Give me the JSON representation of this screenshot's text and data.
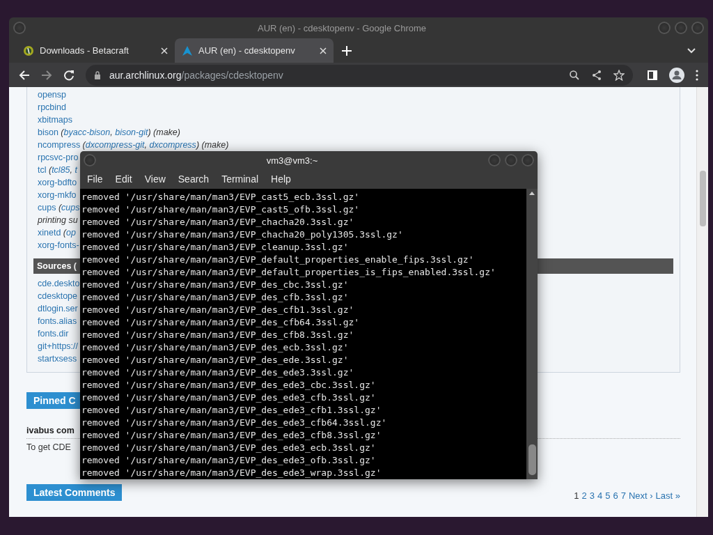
{
  "browser": {
    "window_title": "AUR (en) - cdesktopenv - Google Chrome",
    "tabs": [
      {
        "title": "Downloads - Betacraft",
        "selected": false
      },
      {
        "title": "AUR (en) - cdesktopenv",
        "selected": true
      }
    ],
    "address": {
      "domain": "aur.archlinux.org",
      "path": "/packages/cdesktopenv"
    }
  },
  "page": {
    "dependencies": [
      {
        "parts": [
          {
            "text": "opensp",
            "kind": "link"
          }
        ]
      },
      {
        "parts": [
          {
            "text": "rpcbind",
            "kind": "link"
          }
        ]
      },
      {
        "parts": [
          {
            "text": "xbitmaps",
            "kind": "link"
          }
        ]
      },
      {
        "parts": [
          {
            "text": "bison",
            "kind": "link"
          },
          {
            "text": " (",
            "kind": "note"
          },
          {
            "text": "byacc-bison",
            "kind": "alt"
          },
          {
            "text": ", ",
            "kind": "note"
          },
          {
            "text": "bison-git",
            "kind": "alt"
          },
          {
            "text": ") (make)",
            "kind": "note"
          }
        ]
      },
      {
        "parts": [
          {
            "text": "ncompress",
            "kind": "link"
          },
          {
            "text": " (",
            "kind": "note"
          },
          {
            "text": "dxcompress-git",
            "kind": "alt"
          },
          {
            "text": ", ",
            "kind": "note"
          },
          {
            "text": "dxcompress",
            "kind": "alt"
          },
          {
            "text": ") (make)",
            "kind": "note"
          }
        ]
      },
      {
        "parts": [
          {
            "text": "rpcsvc-pro",
            "kind": "link"
          }
        ]
      },
      {
        "parts": [
          {
            "text": "tcl",
            "kind": "link"
          },
          {
            "text": " (",
            "kind": "note"
          },
          {
            "text": "tcl85",
            "kind": "alt"
          },
          {
            "text": ", ",
            "kind": "note"
          },
          {
            "text": "t",
            "kind": "alt"
          }
        ]
      },
      {
        "parts": [
          {
            "text": "xorg-bdfto",
            "kind": "link"
          }
        ]
      },
      {
        "parts": [
          {
            "text": "xorg-mkfo",
            "kind": "link"
          }
        ]
      },
      {
        "parts": [
          {
            "text": "cups",
            "kind": "link"
          },
          {
            "text": " (",
            "kind": "note"
          },
          {
            "text": "cups",
            "kind": "alt"
          }
        ]
      },
      {
        "parts": [
          {
            "text": "printing su",
            "kind": "note"
          }
        ]
      },
      {
        "parts": [
          {
            "text": "xinetd",
            "kind": "link"
          },
          {
            "text": " (",
            "kind": "note"
          },
          {
            "text": "op",
            "kind": "alt"
          }
        ]
      },
      {
        "parts": [
          {
            "text": "xorg-fonts-",
            "kind": "link"
          }
        ]
      }
    ],
    "sources_heading": "Sources (",
    "sources": [
      "cde.deskto",
      "cdesktope",
      "dtlogin.ser",
      "fonts.alias",
      "fonts.dir",
      "git+https://",
      "startxsess"
    ],
    "pinned_heading": "Pinned C",
    "comment": {
      "author": "ivabus com",
      "text": "To get CDE"
    },
    "latest_heading": "Latest Comments",
    "pagination": {
      "pages": [
        {
          "label": "1",
          "selected": true
        },
        {
          "label": "2",
          "selected": false
        },
        {
          "label": "3",
          "selected": false
        },
        {
          "label": "4",
          "selected": false
        },
        {
          "label": "5",
          "selected": false
        },
        {
          "label": "6",
          "selected": false
        },
        {
          "label": "7",
          "selected": false
        }
      ],
      "next": "Next ›",
      "last": "Last »"
    }
  },
  "terminal": {
    "title": "vm3@vm3:~",
    "menus": [
      "File",
      "Edit",
      "View",
      "Search",
      "Terminal",
      "Help"
    ],
    "lines": [
      "removed '/usr/share/man/man3/EVP_cast5_ecb.3ssl.gz'",
      "removed '/usr/share/man/man3/EVP_cast5_ofb.3ssl.gz'",
      "removed '/usr/share/man/man3/EVP_chacha20.3ssl.gz'",
      "removed '/usr/share/man/man3/EVP_chacha20_poly1305.3ssl.gz'",
      "removed '/usr/share/man/man3/EVP_cleanup.3ssl.gz'",
      "removed '/usr/share/man/man3/EVP_default_properties_enable_fips.3ssl.gz'",
      "removed '/usr/share/man/man3/EVP_default_properties_is_fips_enabled.3ssl.gz'",
      "removed '/usr/share/man/man3/EVP_des_cbc.3ssl.gz'",
      "removed '/usr/share/man/man3/EVP_des_cfb.3ssl.gz'",
      "removed '/usr/share/man/man3/EVP_des_cfb1.3ssl.gz'",
      "removed '/usr/share/man/man3/EVP_des_cfb64.3ssl.gz'",
      "removed '/usr/share/man/man3/EVP_des_cfb8.3ssl.gz'",
      "removed '/usr/share/man/man3/EVP_des_ecb.3ssl.gz'",
      "removed '/usr/share/man/man3/EVP_des_ede.3ssl.gz'",
      "removed '/usr/share/man/man3/EVP_des_ede3.3ssl.gz'",
      "removed '/usr/share/man/man3/EVP_des_ede3_cbc.3ssl.gz'",
      "removed '/usr/share/man/man3/EVP_des_ede3_cfb.3ssl.gz'",
      "removed '/usr/share/man/man3/EVP_des_ede3_cfb1.3ssl.gz'",
      "removed '/usr/share/man/man3/EVP_des_ede3_cfb64.3ssl.gz'",
      "removed '/usr/share/man/man3/EVP_des_ede3_cfb8.3ssl.gz'",
      "removed '/usr/share/man/man3/EVP_des_ede3_ecb.3ssl.gz'",
      "removed '/usr/share/man/man3/EVP_des_ede3_ofb.3ssl.gz'",
      "removed '/usr/share/man/man3/EVP_des_ede3_wrap.3ssl.gz'"
    ]
  }
}
